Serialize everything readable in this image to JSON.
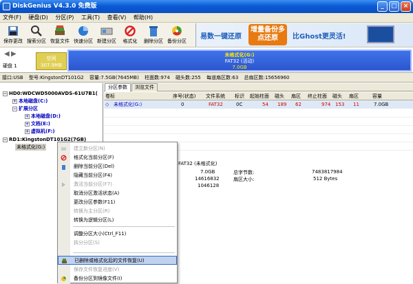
{
  "window": {
    "title": "DiskGenius V4.3.0 免费版"
  },
  "menu": [
    "文件(F)",
    "硬盘(D)",
    "分区(P)",
    "工具(T)",
    "查看(V)",
    "帮助(H)"
  ],
  "toolbar": [
    "保存更改",
    "搜索分区",
    "恢复文件",
    "快速分区",
    "新建分区",
    "格式化",
    "删除分区",
    "备份分区"
  ],
  "banner": {
    "text1": "易数一键还原",
    "text2": "增量备份多点还原",
    "text3": "比Ghost更灵活!"
  },
  "diskbar": {
    "disk_label": "硬盘 1",
    "free_label": "空闲",
    "free_size": "307.9MB",
    "part_name": "未格式化(G:)",
    "part_fs": "FAT32 (活动)",
    "part_size": "7.0GB"
  },
  "diskinfo": [
    "接口:USB",
    "型号:KingstonDT101G2",
    "容量:7.5GB(7645MB)",
    "柱面数:974",
    "磁头数:255",
    "每道扇区数:63",
    "总扇区数:15656960"
  ],
  "tree": {
    "hd0": "HD0:WDCWD5000AVDS-61U7B1(",
    "local_c": "本地磁盘(C:)",
    "ext": "扩展分区",
    "local_d": "本地磁盘(D:)",
    "docs_e": "文档(E:)",
    "vm_f": "虚拟机(F:)",
    "rd1": "RD1:KingstonDT101G2(7GB)",
    "unfmt": "未格式化(G:)"
  },
  "tabs": [
    "分区参数",
    "浏览文件"
  ],
  "table": {
    "headers": [
      "卷标",
      "序号(状态)",
      "文件系统",
      "标识",
      "起始柱面",
      "磁头",
      "扇区",
      "终止柱面",
      "磁头",
      "扇区",
      "容量"
    ],
    "row": [
      "未格式化(G:)",
      "0",
      "FAT32",
      "0C",
      "54",
      "189",
      "62",
      "974",
      "153",
      "11",
      "7.0GB"
    ]
  },
  "detail": {
    "fs_label": "FAT32 (未格式化)",
    "cap": "7.0GB",
    "total_bytes_label": "总字节数:",
    "total_bytes": "7483817984",
    "sectors": "14616832",
    "sector_size_label": "扇区大小:",
    "sector_size": "512 Bytes",
    "start": "1046128"
  },
  "context_menu": [
    {
      "label": "建立新分区(N)",
      "enabled": false
    },
    {
      "label": "格式化当前分区(F)",
      "enabled": true
    },
    {
      "label": "删除当前分区(Del)",
      "enabled": true
    },
    {
      "label": "隐藏当前分区(F4)",
      "enabled": true
    },
    {
      "label": "激活当前分区(F7)",
      "enabled": false
    },
    {
      "label": "取消分区激活状态(A)",
      "enabled": true
    },
    {
      "label": "更改分区参数(F11)",
      "enabled": true
    },
    {
      "label": "转换为主分区(R)",
      "enabled": false
    },
    {
      "label": "转换为逻辑分区(L)",
      "enabled": true
    },
    {
      "label": "调整分区大小(Ctrl_F11)",
      "enabled": true
    },
    {
      "label": "拆分分区(S)",
      "enabled": false
    },
    {
      "label": "已删除或格式化后的文件恢复(U)",
      "enabled": true
    },
    {
      "label": "保存文件恢复进度(V)",
      "enabled": false
    },
    {
      "label": "备份分区到镜像文件(I)",
      "enabled": true
    }
  ]
}
